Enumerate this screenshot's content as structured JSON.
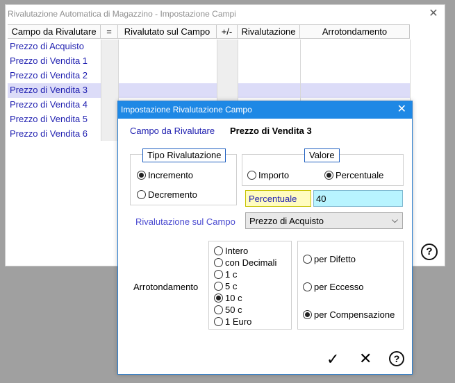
{
  "main_window": {
    "title": "Rivalutazione Automatica di Magazzino - Impostazione Campi",
    "columns": [
      "Campo da Rivalutare",
      "=",
      "Rivalutato sul Campo",
      "+/-",
      "Rivalutazione",
      "Arrotondamento"
    ],
    "rows": [
      "Prezzo di Acquisto",
      "Prezzo di Vendita 1",
      "Prezzo di Vendita 2",
      "Prezzo di Vendita 3",
      "Prezzo di Vendita 4",
      "Prezzo di Vendita 5",
      "Prezzo di Vendita 6"
    ],
    "selected_row": "Prezzo di Vendita 3",
    "help_label": "?"
  },
  "dialog": {
    "title": "Impostazione Rivalutazione Campo",
    "campo_label": "Campo da Rivalutare",
    "campo_value": "Prezzo di Vendita 3",
    "tipo_group": {
      "legend": "Tipo Rivalutazione",
      "options": [
        {
          "label": "Incremento",
          "checked": true
        },
        {
          "label": "Decremento",
          "checked": false
        }
      ]
    },
    "valore_group": {
      "legend": "Valore",
      "options": [
        {
          "label": "Importo",
          "checked": false
        },
        {
          "label": "Percentuale",
          "checked": true
        }
      ],
      "field_label": "Percentuale",
      "field_value": "40"
    },
    "rivalutazione_label": "Rivalutazione sul Campo",
    "rivalutazione_selected": "Prezzo di Acquisto",
    "arrotondamento_label": "Arrotondamento",
    "arrotondamento_options": [
      {
        "label": "Intero",
        "checked": false
      },
      {
        "label": "con Decimali",
        "checked": false
      },
      {
        "label": "1 c",
        "checked": false
      },
      {
        "label": "5 c",
        "checked": false
      },
      {
        "label": "10 c",
        "checked": true
      },
      {
        "label": "50 c",
        "checked": false
      },
      {
        "label": "1 Euro",
        "checked": false
      }
    ],
    "metodo_options": [
      {
        "label": "per Difetto",
        "checked": false
      },
      {
        "label": "per Eccesso",
        "checked": false
      },
      {
        "label": "per Compensazione",
        "checked": true
      }
    ],
    "buttons": {
      "ok": "✓",
      "cancel": "✕",
      "help": "?"
    }
  },
  "colors": {
    "accent": "#1e88e5",
    "link_text": "#1f1fb0",
    "selected_row": "#dcdcf8",
    "input_bg": "#b8f4ff",
    "label_bg": "#fffcc0"
  }
}
